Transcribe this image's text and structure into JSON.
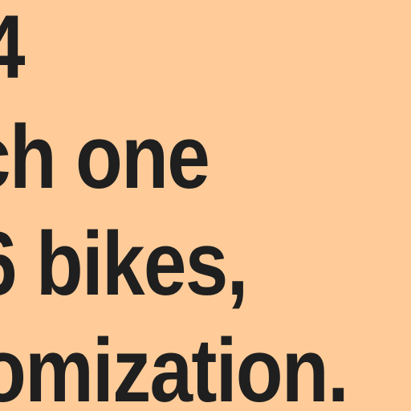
{
  "text_fragment": {
    "lines": [
      "4",
      "ch one",
      "6 bikes,",
      "omization."
    ]
  },
  "colors": {
    "background": "#FFCC99",
    "text": "#1F1F1F"
  }
}
